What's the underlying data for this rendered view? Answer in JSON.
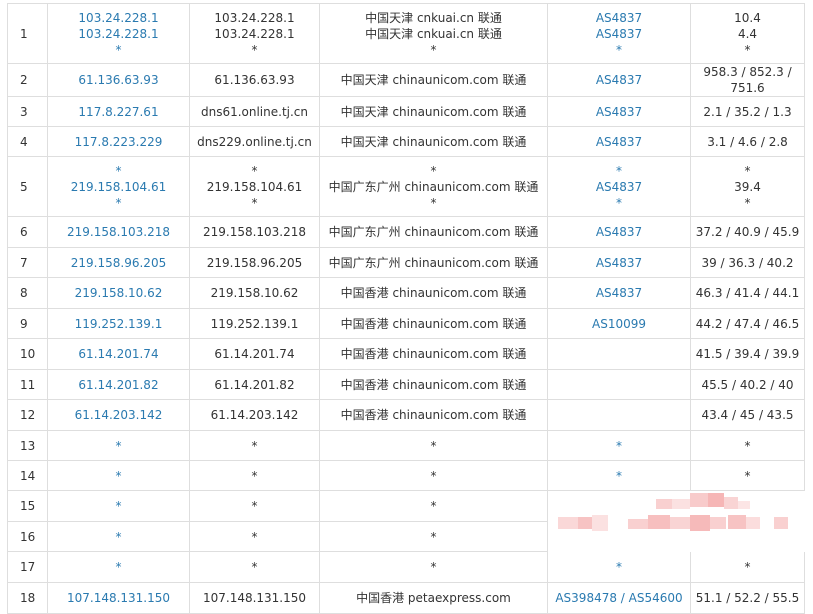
{
  "rows": [
    {
      "hop": "1",
      "ip": [
        "103.24.228.1",
        "103.24.228.1",
        "*"
      ],
      "host": [
        "103.24.228.1",
        "103.24.228.1",
        "*"
      ],
      "loc": [
        "中国天津 cnkuai.cn 联通",
        "中国天津 cnkuai.cn 联通",
        "*"
      ],
      "asn": [
        "AS4837",
        "AS4837",
        "*"
      ],
      "rtt": [
        "10.4",
        "4.4",
        "*"
      ]
    },
    {
      "hop": "2",
      "ip": "61.136.63.93",
      "host": "61.136.63.93",
      "loc": "中国天津 chinaunicom.com 联通",
      "asn": "AS4837",
      "rtt": "958.3 / 852.3 / 751.6"
    },
    {
      "hop": "3",
      "ip": "117.8.227.61",
      "host": "dns61.online.tj.cn",
      "loc": "中国天津 chinaunicom.com 联通",
      "asn": "AS4837",
      "rtt": "2.1 / 35.2 / 1.3"
    },
    {
      "hop": "4",
      "ip": "117.8.223.229",
      "host": "dns229.online.tj.cn",
      "loc": "中国天津 chinaunicom.com 联通",
      "asn": "AS4837",
      "rtt": "3.1 / 4.6 / 2.8"
    },
    {
      "hop": "5",
      "ip": [
        "*",
        "219.158.104.61",
        "*"
      ],
      "host": [
        "*",
        "219.158.104.61",
        "*"
      ],
      "loc": [
        "*",
        "中国广东广州 chinaunicom.com 联通",
        "*"
      ],
      "asn": [
        "*",
        "AS4837",
        "*"
      ],
      "rtt": [
        "*",
        "39.4",
        "*"
      ]
    },
    {
      "hop": "6",
      "ip": "219.158.103.218",
      "host": "219.158.103.218",
      "loc": "中国广东广州 chinaunicom.com 联通",
      "asn": "AS4837",
      "rtt": "37.2 / 40.9 / 45.9"
    },
    {
      "hop": "7",
      "ip": "219.158.96.205",
      "host": "219.158.96.205",
      "loc": "中国广东广州 chinaunicom.com 联通",
      "asn": "AS4837",
      "rtt": "39 / 36.3 / 40.2"
    },
    {
      "hop": "8",
      "ip": "219.158.10.62",
      "host": "219.158.10.62",
      "loc": "中国香港 chinaunicom.com 联通",
      "asn": "AS4837",
      "rtt": "46.3 / 41.4 / 44.1"
    },
    {
      "hop": "9",
      "ip": "119.252.139.1",
      "host": "119.252.139.1",
      "loc": "中国香港 chinaunicom.com 联通",
      "asn": "AS10099",
      "rtt": "44.2 / 47.4 / 46.5"
    },
    {
      "hop": "10",
      "ip": "61.14.201.74",
      "host": "61.14.201.74",
      "loc": "中国香港 chinaunicom.com 联通",
      "asn": "",
      "rtt": "41.5 / 39.4 / 39.9"
    },
    {
      "hop": "11",
      "ip": "61.14.201.82",
      "host": "61.14.201.82",
      "loc": "中国香港 chinaunicom.com 联通",
      "asn": "",
      "rtt": "45.5 / 40.2 / 40"
    },
    {
      "hop": "12",
      "ip": "61.14.203.142",
      "host": "61.14.203.142",
      "loc": "中国香港 chinaunicom.com 联通",
      "asn": "",
      "rtt": "43.4 / 45 / 43.5"
    },
    {
      "hop": "13",
      "ip": "*",
      "host": "*",
      "loc": "*",
      "asn": "*",
      "rtt": "*"
    },
    {
      "hop": "14",
      "ip": "*",
      "host": "*",
      "loc": "*",
      "asn": "*",
      "rtt": "*"
    },
    {
      "hop": "15",
      "ip": "*",
      "host": "*",
      "loc": "*",
      "asn": "",
      "rtt": "",
      "blurred": true
    },
    {
      "hop": "16",
      "ip": "*",
      "host": "*",
      "loc": "*",
      "asn": "",
      "rtt": "",
      "blurred": true
    },
    {
      "hop": "17",
      "ip": "*",
      "host": "*",
      "loc": "*",
      "asn": "*",
      "rtt": "*"
    },
    {
      "hop": "18",
      "ip": "107.148.131.150",
      "host": "107.148.131.150",
      "loc": "中国香港 petaexpress.com",
      "asn": "AS398478 / AS54600",
      "rtt": "51.1 / 52.2 / 55.5"
    }
  ],
  "colors": {
    "link": "#2a7ab0",
    "text": "#333333",
    "border": "#dedede",
    "mosaic": "#f4a9a9"
  }
}
